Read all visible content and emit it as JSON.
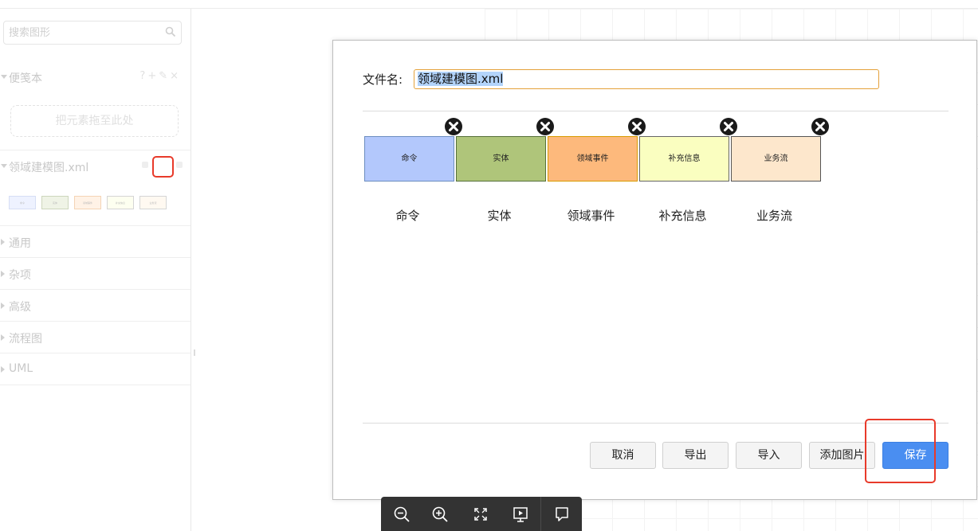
{
  "sidebar": {
    "search_placeholder": "搜索图形",
    "scratchpad": {
      "title": "便笺本",
      "actions": "?+✎×",
      "drop_hint": "把元素拖至此处"
    },
    "library": {
      "title": "领域建模图.xml",
      "thumbs": [
        "命令",
        "实体",
        "领域事件",
        "补充信息",
        "业务流"
      ]
    },
    "sections": [
      "通用",
      "杂项",
      "高级",
      "流程图",
      "UML"
    ]
  },
  "dialog": {
    "filename_label": "文件名:",
    "filename_value": "领域建模图.xml",
    "shapes": [
      {
        "text": "命令",
        "label": "命令",
        "fill": "#b3c8fc",
        "stroke": "#6c8ebf"
      },
      {
        "text": "实体",
        "label": "实体",
        "fill": "#afc57a",
        "stroke": "#56703a"
      },
      {
        "text": "领域事件",
        "label": "领域事件",
        "fill": "#fdb97c",
        "stroke": "#d79b00"
      },
      {
        "text": "补充信息",
        "label": "补充信息",
        "fill": "#fafec0",
        "stroke": "#666666"
      },
      {
        "text": "业务流",
        "label": "业务流",
        "fill": "#fde7cc",
        "stroke": "#555555"
      }
    ],
    "buttons": {
      "cancel": "取消",
      "export": "导出",
      "import": "导入",
      "add_image": "添加图片",
      "save": "保存"
    }
  },
  "colors": {
    "highlight": "#e83a2a",
    "primary_button": "#4a8ef1",
    "input_focus_border": "#e4a13a",
    "toolbar_bg": "#333333"
  },
  "toolbar_icons": [
    "zoom-out-icon",
    "zoom-in-icon",
    "fit-icon",
    "present-icon",
    "comment-icon"
  ]
}
